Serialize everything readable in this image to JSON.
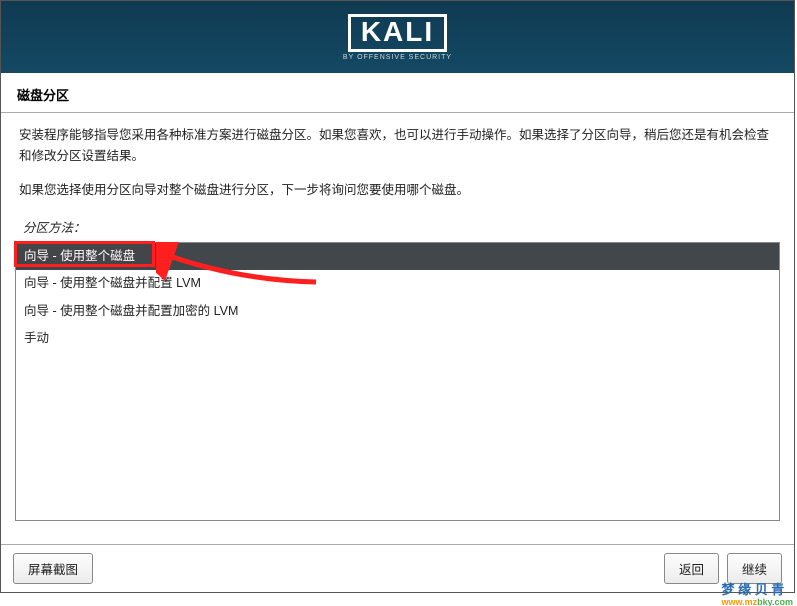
{
  "logo": {
    "main": "KALI",
    "sub": "BY OFFENSIVE SECURITY"
  },
  "page_title": "磁盘分区",
  "intro": {
    "p1": "安装程序能够指导您采用各种标准方案进行磁盘分区。如果您喜欢，也可以进行手动操作。如果选择了分区向导，稍后您还是有机会检查和修改分区设置结果。",
    "p2": "如果您选择使用分区向导对整个磁盘进行分区，下一步将询问您要使用哪个磁盘。"
  },
  "method_label": "分区方法：",
  "options": [
    {
      "label": "向导 - 使用整个磁盘",
      "selected": true
    },
    {
      "label": "向导 - 使用整个磁盘并配置 LVM",
      "selected": false
    },
    {
      "label": "向导 - 使用整个磁盘并配置加密的 LVM",
      "selected": false
    },
    {
      "label": "手动",
      "selected": false
    }
  ],
  "buttons": {
    "screenshot": "屏幕截图",
    "back": "返回",
    "continue": "继续"
  },
  "watermark": {
    "cn": "梦 缘 贝 青",
    "url": "www.mzbky.com"
  }
}
